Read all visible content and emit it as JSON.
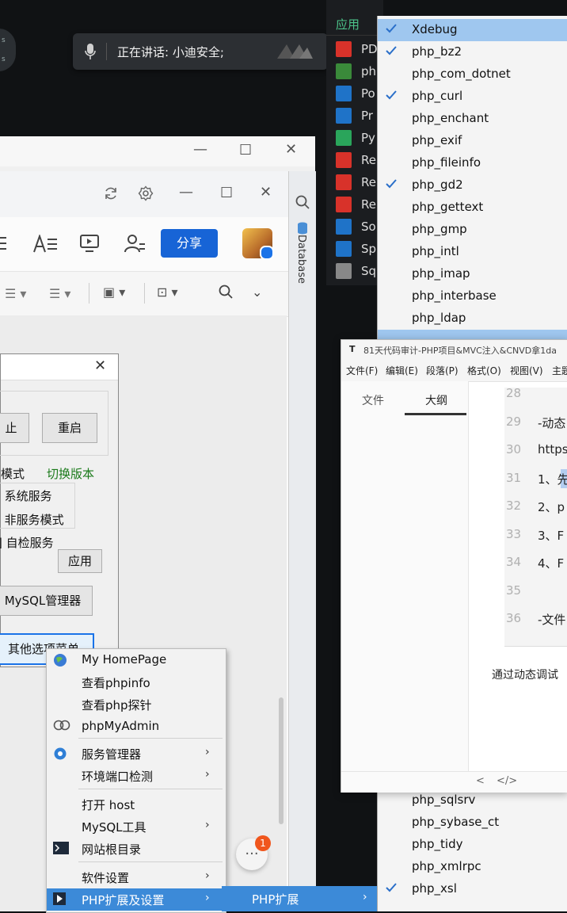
{
  "speaking": {
    "text": "正在讲话: 小迪安全;",
    "left_avatar_text": [
      "s",
      "s"
    ]
  },
  "app_panel": {
    "header": "应用",
    "items": [
      {
        "label": "PD",
        "color": "#d8322a"
      },
      {
        "label": "ph",
        "color": "#3a8a3a"
      },
      {
        "label": "Po",
        "color": "#1f73c8"
      },
      {
        "label": "Pr",
        "color": "#1f73c8"
      },
      {
        "label": "Py",
        "color": "#2aa55b"
      },
      {
        "label": "Re",
        "color": "#d8322a"
      },
      {
        "label": "Re",
        "color": "#d8322a"
      },
      {
        "label": "Re",
        "color": "#d8322a"
      },
      {
        "label": "So",
        "color": "#1f73c8"
      },
      {
        "label": "Sp",
        "color": "#1f73c8"
      },
      {
        "label": "Sq",
        "color": "#888888"
      }
    ]
  },
  "note_window": {
    "share_label": "分享",
    "db_label": "Database"
  },
  "phpstudy": {
    "stop_label": "止",
    "restart_label": "重启",
    "mode_label": "模式",
    "switch_version": "切换版本",
    "system_service": "系统服务",
    "non_service": "非服务模式",
    "self_check": "自检服务",
    "apply_label": "应用",
    "mysql_manager": "MySQL管理器",
    "other_options": "其他选项菜单"
  },
  "context_menu": {
    "items": [
      {
        "label": "My HomePage",
        "icon": "globe-icon"
      },
      {
        "label": "查看phpinfo"
      },
      {
        "label": "查看php探针"
      },
      {
        "label": "phpMyAdmin",
        "icon": "link-icon"
      },
      {
        "label": "服务管理器",
        "icon": "gear-icon",
        "submenu": true
      },
      {
        "label": "环境端口检测",
        "submenu": true
      },
      {
        "label": "打开 host"
      },
      {
        "label": "MySQL工具",
        "submenu": true
      },
      {
        "label": "网站根目录",
        "icon": "terminal-icon"
      },
      {
        "label": "软件设置",
        "submenu": true
      },
      {
        "label": "PHP扩展及设置",
        "submenu": true,
        "active": true
      }
    ],
    "submenu_label": "PHP扩展",
    "badge_count": "1",
    "more_label": "···"
  },
  "extensions": {
    "items": [
      {
        "label": "Xdebug",
        "checked": true,
        "highlighted": true
      },
      {
        "label": "php_bz2",
        "checked": true
      },
      {
        "label": "php_com_dotnet",
        "checked": false
      },
      {
        "label": "php_curl",
        "checked": true
      },
      {
        "label": "php_enchant",
        "checked": false
      },
      {
        "label": "php_exif",
        "checked": false
      },
      {
        "label": "php_fileinfo",
        "checked": false
      },
      {
        "label": "php_gd2",
        "checked": true
      },
      {
        "label": "php_gettext",
        "checked": false
      },
      {
        "label": "php_gmp",
        "checked": false
      },
      {
        "label": "php_intl",
        "checked": false
      },
      {
        "label": "php_imap",
        "checked": false
      },
      {
        "label": "php_interbase",
        "checked": false
      },
      {
        "label": "php_ldap",
        "checked": false
      }
    ],
    "bottom_items": [
      {
        "label": "php_sqlsrv",
        "checked": false
      },
      {
        "label": "php_sybase_ct",
        "checked": false
      },
      {
        "label": "php_tidy",
        "checked": false
      },
      {
        "label": "php_xmlrpc",
        "checked": false
      },
      {
        "label": "php_xsl",
        "checked": true
      }
    ]
  },
  "typora": {
    "app_letter": "T",
    "title": "81天代码审计-PHP项目&MVC注入&CNVD拿1da",
    "menu": [
      "文件(F)",
      "编辑(E)",
      "段落(P)",
      "格式(O)",
      "视图(V)",
      "主题"
    ],
    "tabs": [
      "文件",
      "大纲"
    ],
    "code_lines": [
      {
        "n": "28",
        "c": ""
      },
      {
        "n": "29",
        "c": "-动态"
      },
      {
        "n": "30",
        "c": "https"
      },
      {
        "n": "31",
        "c": "1、先"
      },
      {
        "n": "32",
        "c": "2、p"
      },
      {
        "n": "33",
        "c": "3、F"
      },
      {
        "n": "34",
        "c": "4、F"
      },
      {
        "n": "35",
        "c": ""
      },
      {
        "n": "36",
        "c": "-文件"
      }
    ],
    "paragraph": "通过动态调试",
    "status_left": "<",
    "status_right": "</>"
  }
}
